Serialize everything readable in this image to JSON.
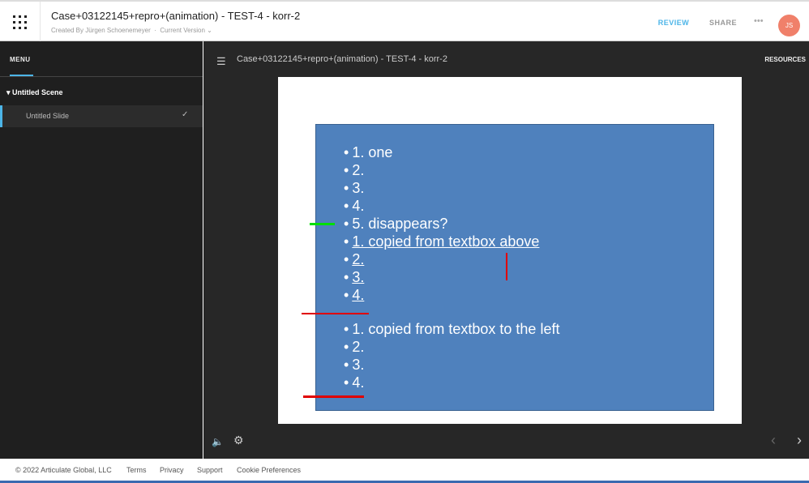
{
  "header": {
    "title": "Case+03122145+repro+(animation) - TEST-4 - korr-2",
    "created_by": "Created By Jürgen Schoenemeyer",
    "separator": "·",
    "version": "Current Version ⌄",
    "tabs": {
      "review": "REVIEW",
      "share": "SHARE"
    },
    "more": "•••",
    "avatar": "JS"
  },
  "sidebar": {
    "menu_tab": "MENU",
    "scene": "▾  Untitled Scene",
    "slide": "Untitled Slide",
    "check": "✓"
  },
  "player": {
    "hamburger": "☰",
    "title": "Case+03122145+repro+(animation) - TEST-4 - korr-2",
    "resources": "RESOURCES",
    "volume": "🔈",
    "settings": "⚙",
    "prev": "‹",
    "next": "›"
  },
  "slide": {
    "bullet": "•",
    "lines": [
      {
        "text": "1. one",
        "underline": false
      },
      {
        "text": "2.",
        "underline": false
      },
      {
        "text": "3.",
        "underline": false
      },
      {
        "text": "4.",
        "underline": false
      },
      {
        "text": "5. disappears?",
        "underline": false
      },
      {
        "text": "1. copied from textbox above",
        "underline": true
      },
      {
        "text": "2. ",
        "underline": true
      },
      {
        "text": "3.",
        "underline": true
      },
      {
        "text": "4.",
        "underline": true
      },
      {
        "text": "1. copied from textbox to the left",
        "underline": false
      },
      {
        "text": "2.",
        "underline": false
      },
      {
        "text": "3.",
        "underline": false
      },
      {
        "text": "4.",
        "underline": false
      }
    ],
    "mark_colors": {
      "green": "#00e000",
      "red": "#e00000"
    },
    "box_color": "#4f81bd"
  },
  "footer": {
    "copyright": "© 2022 Articulate Global, LLC",
    "terms": "Terms",
    "privacy": "Privacy",
    "support": "Support",
    "cookies": "Cookie Preferences"
  }
}
